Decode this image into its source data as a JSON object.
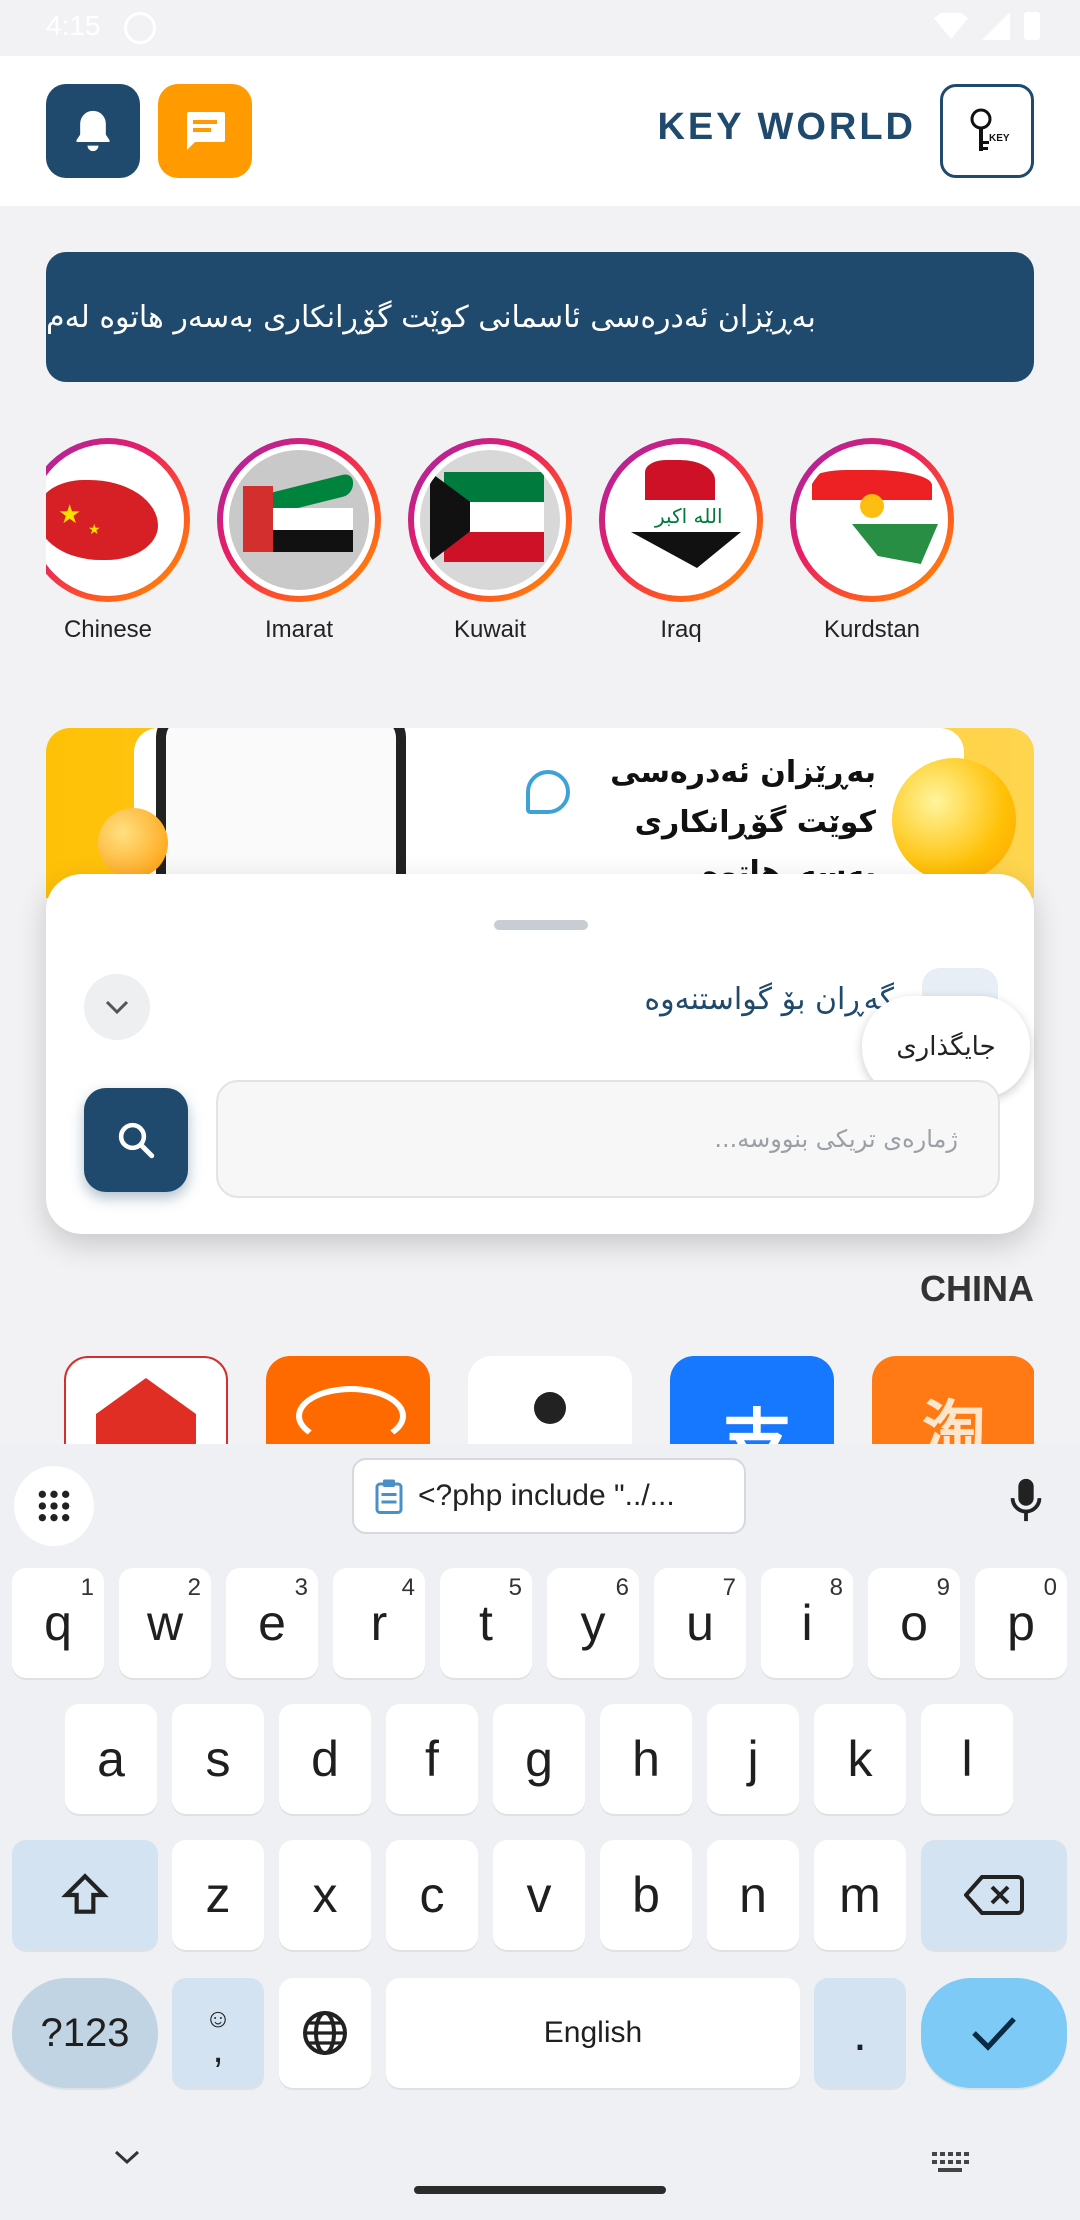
{
  "status_bar": {
    "time": "4:15"
  },
  "header": {
    "brand_title": "KEY WORLD",
    "logo_text": "KEY WORLD"
  },
  "marquee": {
    "text": "بەڕێزان ئەدرەسی ئاسمانی کوێت گۆڕانکاری بەسەر هاتوە لەم"
  },
  "stories": [
    {
      "label": "Chinese"
    },
    {
      "label": "Imarat"
    },
    {
      "label": "Kuwait"
    },
    {
      "label": "Iraq"
    },
    {
      "label": "Kurdstan"
    }
  ],
  "banner": {
    "line1": "بەڕێزان ئەدرەسی",
    "line2": "کوێت گۆڕانکاری",
    "line3": "بەسەرهاتوە"
  },
  "sheet": {
    "title": "گەڕان بۆ گواستنەوە",
    "location_chip": "جایگذاری",
    "input_placeholder": "ژمارەی تریکی بنووسە..."
  },
  "section": {
    "title": "CHINA"
  },
  "keyboard": {
    "clipboard_text": "<?php include \"../...",
    "row1": [
      {
        "k": "q",
        "h": "1"
      },
      {
        "k": "w",
        "h": "2"
      },
      {
        "k": "e",
        "h": "3"
      },
      {
        "k": "r",
        "h": "4"
      },
      {
        "k": "t",
        "h": "5"
      },
      {
        "k": "y",
        "h": "6"
      },
      {
        "k": "u",
        "h": "7"
      },
      {
        "k": "i",
        "h": "8"
      },
      {
        "k": "o",
        "h": "9"
      },
      {
        "k": "p",
        "h": "0"
      }
    ],
    "row2": [
      "a",
      "s",
      "d",
      "f",
      "g",
      "h",
      "j",
      "k",
      "l"
    ],
    "row3": [
      "z",
      "x",
      "c",
      "v",
      "b",
      "n",
      "m"
    ],
    "symbols_key": "?123",
    "comma_key": ",",
    "space_key": "English",
    "period_key": ".",
    "colors": {
      "enter": "#7dcaf7",
      "modifier": "#d3e3f2"
    }
  },
  "colors": {
    "primary": "#1f4a6e",
    "accent": "#ff9a00"
  }
}
